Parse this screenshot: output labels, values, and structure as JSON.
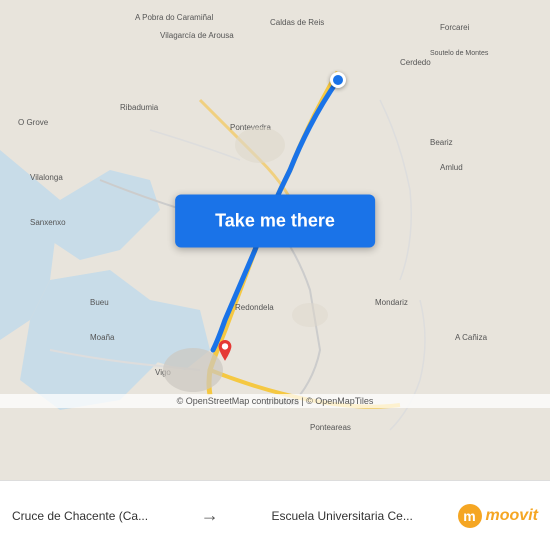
{
  "map": {
    "background_color": "#e8e0d8",
    "route_color": "#1a73e8",
    "button_label": "Take me there",
    "button_color": "#1a73e8",
    "origin_pin_color": "#e53935",
    "dest_dot_color": "#1a73e8"
  },
  "attribution": {
    "text": "© OpenStreetMap contributors | © OpenMapTiles"
  },
  "bottom_bar": {
    "origin": "Cruce de Chacente (Ca...",
    "destination": "Escuela Universitaria Ce...",
    "arrow": "→",
    "moovit": "moovit"
  }
}
